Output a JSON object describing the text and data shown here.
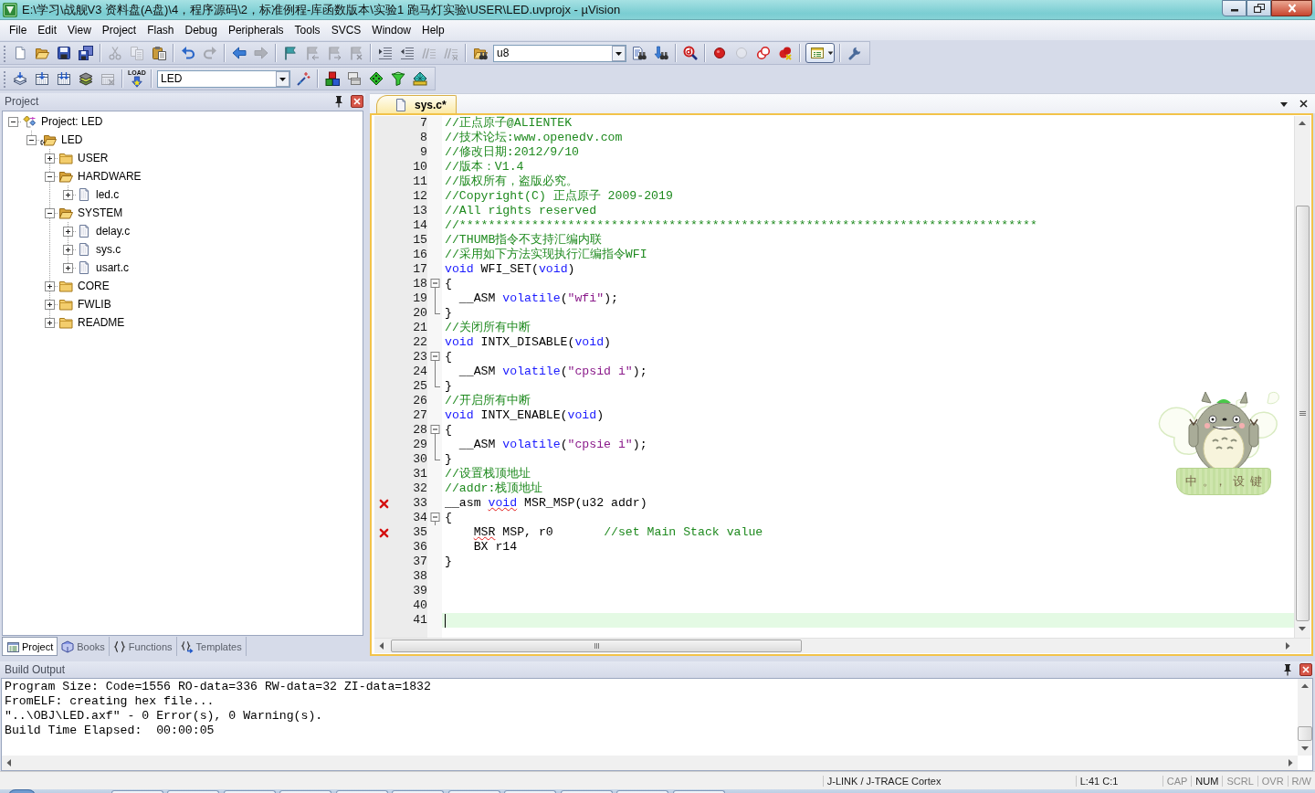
{
  "window": {
    "title": "E:\\学习\\战舰V3 资料盘(A盘)\\4，程序源码\\2，标准例程-库函数版本\\实验1 跑马灯实验\\USER\\LED.uvprojx - µVision"
  },
  "menu": [
    "File",
    "Edit",
    "View",
    "Project",
    "Flash",
    "Debug",
    "Peripherals",
    "Tools",
    "SVCS",
    "Window",
    "Help"
  ],
  "toolbar_1": {
    "items": [
      {
        "kind": "new-file",
        "disabled": false
      },
      {
        "kind": "open",
        "disabled": false
      },
      {
        "kind": "save",
        "disabled": false
      },
      {
        "kind": "save-all",
        "disabled": false
      },
      {
        "kind": "separator"
      },
      {
        "kind": "cut",
        "disabled": true
      },
      {
        "kind": "copy",
        "disabled": true
      },
      {
        "kind": "paste",
        "disabled": false
      },
      {
        "kind": "separator"
      },
      {
        "kind": "undo",
        "disabled": false
      },
      {
        "kind": "redo",
        "disabled": true
      },
      {
        "kind": "separator"
      },
      {
        "kind": "back",
        "disabled": false
      },
      {
        "kind": "forward",
        "disabled": true
      },
      {
        "kind": "separator"
      },
      {
        "kind": "bookmark",
        "disabled": false
      },
      {
        "kind": "bookmark-prev",
        "disabled": true
      },
      {
        "kind": "bookmark-next",
        "disabled": true
      },
      {
        "kind": "bookmark-clear",
        "disabled": true
      },
      {
        "kind": "separator"
      },
      {
        "kind": "indent",
        "disabled": false
      },
      {
        "kind": "outdent",
        "disabled": false
      },
      {
        "kind": "comment",
        "disabled": true
      },
      {
        "kind": "uncomment",
        "disabled": true
      },
      {
        "kind": "separator"
      },
      {
        "kind": "find-in-files",
        "disabled": false
      },
      {
        "kind": "combo",
        "value": "u8"
      },
      {
        "kind": "find",
        "disabled": false
      },
      {
        "kind": "incremental-find",
        "disabled": false
      },
      {
        "kind": "separator"
      },
      {
        "kind": "debug",
        "disabled": false
      },
      {
        "kind": "separator"
      },
      {
        "kind": "breakpoint",
        "disabled": false
      },
      {
        "kind": "breakpoint-toggle",
        "disabled": true
      },
      {
        "kind": "breakpoint-disable-all",
        "disabled": false
      },
      {
        "kind": "breakpoint-kill",
        "disabled": false
      },
      {
        "kind": "separator"
      },
      {
        "kind": "window-layout",
        "on": true
      },
      {
        "kind": "separator"
      },
      {
        "kind": "configure",
        "disabled": false
      }
    ]
  },
  "toolbar_2": {
    "items": [
      {
        "kind": "translate",
        "disabled": false
      },
      {
        "kind": "build",
        "disabled": false
      },
      {
        "kind": "rebuild",
        "disabled": false
      },
      {
        "kind": "batch-build",
        "disabled": false
      },
      {
        "kind": "stop-build",
        "disabled": true
      },
      {
        "kind": "separator"
      },
      {
        "kind": "download",
        "caption": "LOAD",
        "disabled": false
      },
      {
        "kind": "separator"
      },
      {
        "kind": "combo",
        "value": "LED"
      },
      {
        "kind": "options",
        "disabled": false
      },
      {
        "kind": "separator"
      },
      {
        "kind": "components",
        "disabled": false
      },
      {
        "kind": "file-extensions",
        "disabled": false
      },
      {
        "kind": "packs",
        "disabled": false
      },
      {
        "kind": "select-packs",
        "disabled": false
      },
      {
        "kind": "pack-installer",
        "disabled": false
      }
    ]
  },
  "project_panel": {
    "title": "Project",
    "tree": [
      {
        "label": "Project: LED",
        "kind": "project",
        "expanded": true,
        "children": [
          {
            "label": "LED",
            "kind": "target",
            "expanded": true,
            "children": [
              {
                "label": "USER",
                "kind": "group",
                "expanded": false
              },
              {
                "label": "HARDWARE",
                "kind": "group",
                "expanded": true,
                "children": [
                  {
                    "label": "led.c",
                    "kind": "file",
                    "expanded": false
                  }
                ]
              },
              {
                "label": "SYSTEM",
                "kind": "group",
                "expanded": true,
                "children": [
                  {
                    "label": "delay.c",
                    "kind": "file",
                    "expanded": false
                  },
                  {
                    "label": "sys.c",
                    "kind": "file",
                    "expanded": false
                  },
                  {
                    "label": "usart.c",
                    "kind": "file",
                    "expanded": false
                  }
                ]
              },
              {
                "label": "CORE",
                "kind": "group",
                "expanded": false
              },
              {
                "label": "FWLIB",
                "kind": "group",
                "expanded": false
              },
              {
                "label": "README",
                "kind": "group",
                "expanded": false
              }
            ]
          }
        ]
      }
    ],
    "tabs": [
      {
        "label": "Project",
        "kind": "project",
        "selected": true
      },
      {
        "label": "Books",
        "kind": "books",
        "selected": false
      },
      {
        "label": "Functions",
        "kind": "functions",
        "selected": false
      },
      {
        "label": "Templates",
        "kind": "templates",
        "selected": false
      }
    ]
  },
  "editor": {
    "tabs": [
      {
        "label": "sys.c*",
        "selected": true
      }
    ],
    "lines": [
      {
        "number": "7",
        "kind": "plain",
        "error": false,
        "current": false,
        "tokens": [
          {
            "kind": "comment",
            "text": "//正点原子@ALIENTEK",
            "squiggle": false
          }
        ]
      },
      {
        "number": "8",
        "kind": "plain",
        "error": false,
        "current": false,
        "tokens": [
          {
            "kind": "comment",
            "text": "//技术论坛:www.openedv.com",
            "squiggle": false
          }
        ]
      },
      {
        "number": "9",
        "kind": "plain",
        "error": false,
        "current": false,
        "tokens": [
          {
            "kind": "comment",
            "text": "//修改日期:2012/9/10",
            "squiggle": false
          }
        ]
      },
      {
        "number": "10",
        "kind": "plain",
        "error": false,
        "current": false,
        "tokens": [
          {
            "kind": "comment",
            "text": "//版本：V1.4",
            "squiggle": false
          }
        ]
      },
      {
        "number": "11",
        "kind": "plain",
        "error": false,
        "current": false,
        "tokens": [
          {
            "kind": "comment",
            "text": "//版权所有，盗版必究。",
            "squiggle": false
          }
        ]
      },
      {
        "number": "12",
        "kind": "plain",
        "error": false,
        "current": false,
        "tokens": [
          {
            "kind": "comment",
            "text": "//Copyright(C) 正点原子 2009-2019",
            "squiggle": false
          }
        ]
      },
      {
        "number": "13",
        "kind": "plain",
        "error": false,
        "current": false,
        "tokens": [
          {
            "kind": "comment",
            "text": "//All rights reserved",
            "squiggle": false
          }
        ]
      },
      {
        "number": "14",
        "kind": "plain",
        "error": false,
        "current": false,
        "tokens": [
          {
            "kind": "comment",
            "text": "//********************************************************************************",
            "squiggle": false
          }
        ]
      },
      {
        "number": "15",
        "kind": "plain",
        "error": false,
        "current": false,
        "tokens": [
          {
            "kind": "comment",
            "text": "//THUMB指令不支持汇编内联",
            "squiggle": false
          }
        ]
      },
      {
        "number": "16",
        "kind": "plain",
        "error": false,
        "current": false,
        "tokens": [
          {
            "kind": "comment",
            "text": "//采用如下方法实现执行汇编指令WFI",
            "squiggle": false
          }
        ]
      },
      {
        "number": "17",
        "kind": "plain",
        "error": false,
        "current": false,
        "tokens": [
          {
            "kind": "keyword",
            "text": "void",
            "squiggle": false
          },
          {
            "kind": "plain",
            "text": " WFI_SET(",
            "squiggle": false
          },
          {
            "kind": "keyword",
            "text": "void",
            "squiggle": false
          },
          {
            "kind": "plain",
            "text": ")",
            "squiggle": false
          }
        ]
      },
      {
        "number": "18",
        "kind": "fold-start",
        "error": false,
        "current": false,
        "tokens": [
          {
            "kind": "plain",
            "text": "{",
            "squiggle": false
          }
        ]
      },
      {
        "number": "19",
        "kind": "fold-body",
        "error": false,
        "current": false,
        "tokens": [
          {
            "kind": "plain",
            "text": "  __ASM ",
            "squiggle": false
          },
          {
            "kind": "keyword",
            "text": "volatile",
            "squiggle": false
          },
          {
            "kind": "plain",
            "text": "(",
            "squiggle": false
          },
          {
            "kind": "string",
            "text": "\"wfi\"",
            "squiggle": false
          },
          {
            "kind": "plain",
            "text": ");",
            "squiggle": false
          }
        ]
      },
      {
        "number": "20",
        "kind": "fold-end",
        "error": false,
        "current": false,
        "tokens": [
          {
            "kind": "plain",
            "text": "}",
            "squiggle": false
          }
        ]
      },
      {
        "number": "21",
        "kind": "plain",
        "error": false,
        "current": false,
        "tokens": [
          {
            "kind": "comment",
            "text": "//关闭所有中断",
            "squiggle": false
          }
        ]
      },
      {
        "number": "22",
        "kind": "plain",
        "error": false,
        "current": false,
        "tokens": [
          {
            "kind": "keyword",
            "text": "void",
            "squiggle": false
          },
          {
            "kind": "plain",
            "text": " INTX_DISABLE(",
            "squiggle": false
          },
          {
            "kind": "keyword",
            "text": "void",
            "squiggle": false
          },
          {
            "kind": "plain",
            "text": ")",
            "squiggle": false
          }
        ]
      },
      {
        "number": "23",
        "kind": "fold-start",
        "error": false,
        "current": false,
        "tokens": [
          {
            "kind": "plain",
            "text": "{",
            "squiggle": false
          }
        ]
      },
      {
        "number": "24",
        "kind": "fold-body",
        "error": false,
        "current": false,
        "tokens": [
          {
            "kind": "plain",
            "text": "  __ASM ",
            "squiggle": false
          },
          {
            "kind": "keyword",
            "text": "volatile",
            "squiggle": false
          },
          {
            "kind": "plain",
            "text": "(",
            "squiggle": false
          },
          {
            "kind": "string",
            "text": "\"cpsid i\"",
            "squiggle": false
          },
          {
            "kind": "plain",
            "text": ");",
            "squiggle": false
          }
        ]
      },
      {
        "number": "25",
        "kind": "fold-end",
        "error": false,
        "current": false,
        "tokens": [
          {
            "kind": "plain",
            "text": "}",
            "squiggle": false
          }
        ]
      },
      {
        "number": "26",
        "kind": "plain",
        "error": false,
        "current": false,
        "tokens": [
          {
            "kind": "comment",
            "text": "//开启所有中断",
            "squiggle": false
          }
        ]
      },
      {
        "number": "27",
        "kind": "plain",
        "error": false,
        "current": false,
        "tokens": [
          {
            "kind": "keyword",
            "text": "void",
            "squiggle": false
          },
          {
            "kind": "plain",
            "text": " INTX_ENABLE(",
            "squiggle": false
          },
          {
            "kind": "keyword",
            "text": "void",
            "squiggle": false
          },
          {
            "kind": "plain",
            "text": ")",
            "squiggle": false
          }
        ]
      },
      {
        "number": "28",
        "kind": "fold-start",
        "error": false,
        "current": false,
        "tokens": [
          {
            "kind": "plain",
            "text": "{",
            "squiggle": false
          }
        ]
      },
      {
        "number": "29",
        "kind": "fold-body",
        "error": false,
        "current": false,
        "tokens": [
          {
            "kind": "plain",
            "text": "  __ASM ",
            "squiggle": false
          },
          {
            "kind": "keyword",
            "text": "volatile",
            "squiggle": false
          },
          {
            "kind": "plain",
            "text": "(",
            "squiggle": false
          },
          {
            "kind": "string",
            "text": "\"cpsie i\"",
            "squiggle": false
          },
          {
            "kind": "plain",
            "text": ");",
            "squiggle": false
          }
        ]
      },
      {
        "number": "30",
        "kind": "fold-end",
        "error": false,
        "current": false,
        "tokens": [
          {
            "kind": "plain",
            "text": "}",
            "squiggle": false
          }
        ]
      },
      {
        "number": "31",
        "kind": "plain",
        "error": false,
        "current": false,
        "tokens": [
          {
            "kind": "comment",
            "text": "//设置栈顶地址",
            "squiggle": false
          }
        ]
      },
      {
        "number": "32",
        "kind": "plain",
        "error": false,
        "current": false,
        "tokens": [
          {
            "kind": "comment",
            "text": "//addr:栈顶地址",
            "squiggle": false
          }
        ]
      },
      {
        "number": "33",
        "kind": "plain",
        "error": true,
        "current": false,
        "tokens": [
          {
            "kind": "plain",
            "text": "__asm ",
            "squiggle": false
          },
          {
            "kind": "keyword",
            "text": "void",
            "squiggle": true
          },
          {
            "kind": "plain",
            "text": " MSR_MSP(u32 addr)",
            "squiggle": false
          }
        ]
      },
      {
        "number": "34",
        "kind": "fold-start",
        "error": false,
        "current": false,
        "tokens": [
          {
            "kind": "plain",
            "text": "{",
            "squiggle": false
          }
        ]
      },
      {
        "number": "35",
        "kind": "plain",
        "error": true,
        "current": false,
        "tokens": [
          {
            "kind": "plain",
            "text": "    MSR",
            "squiggle": true
          },
          {
            "kind": "plain",
            "text": " MSP, r0       ",
            "squiggle": false
          },
          {
            "kind": "comment",
            "text": "//set Main Stack value",
            "squiggle": false
          }
        ]
      },
      {
        "number": "36",
        "kind": "plain",
        "error": false,
        "current": false,
        "tokens": [
          {
            "kind": "plain",
            "text": "    BX r14",
            "squiggle": false
          }
        ]
      },
      {
        "number": "37",
        "kind": "plain",
        "error": false,
        "current": false,
        "tokens": [
          {
            "kind": "plain",
            "text": "}",
            "squiggle": false
          }
        ]
      },
      {
        "number": "38",
        "kind": "plain",
        "error": false,
        "current": false
      },
      {
        "number": "39",
        "kind": "plain",
        "error": false,
        "current": false
      },
      {
        "number": "40",
        "kind": "plain",
        "error": false,
        "current": false
      },
      {
        "number": "41",
        "kind": "plain",
        "error": false,
        "current": true
      }
    ]
  },
  "ime_status": {
    "items": [
      "中",
      "。，",
      "设",
      "键"
    ]
  },
  "build_output": {
    "title": "Build Output",
    "lines": [
      "Program Size: Code=1556 RO-data=336 RW-data=32 ZI-data=1832",
      "FromELF: creating hex file...",
      "\"..\\OBJ\\LED.axf\" - 0 Error(s), 0 Warning(s).",
      "Build Time Elapsed:  00:00:05"
    ]
  },
  "status_bar": {
    "debugger": "J-LINK / J-TRACE Cortex",
    "position": "L:41 C:1",
    "indicators": [
      {
        "label": "CAP",
        "on": false
      },
      {
        "label": "NUM",
        "on": true
      },
      {
        "label": "SCRL",
        "on": false
      },
      {
        "label": "OVR",
        "on": false
      },
      {
        "label": "R/W",
        "on": false
      }
    ]
  }
}
